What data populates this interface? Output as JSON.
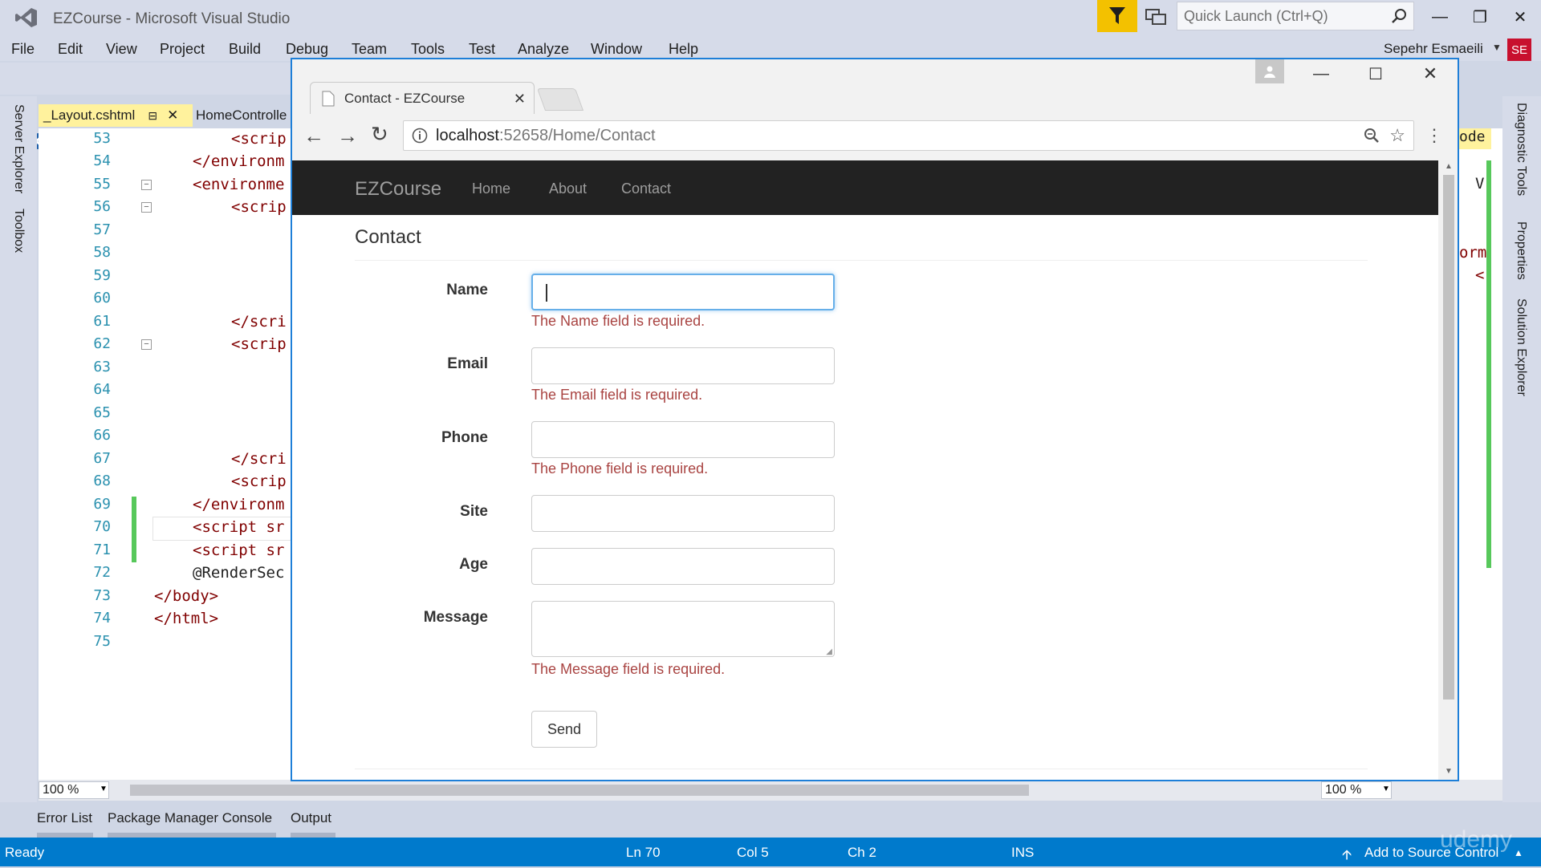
{
  "vs": {
    "title": "EZCourse - Microsoft Visual Studio",
    "quick_launch_placeholder": "Quick Launch (Ctrl+Q)",
    "menu": [
      "File",
      "Edit",
      "View",
      "Project",
      "Build",
      "Debug",
      "Team",
      "Tools",
      "Test",
      "Analyze",
      "Window",
      "Help"
    ],
    "user_name": "Sepehr Esmaeili",
    "user_initials": "SE",
    "left_panels": [
      "Server Explorer",
      "Toolbox"
    ],
    "right_panels": [
      "Diagnostic Tools",
      "Properties",
      "Solution Explorer"
    ],
    "tabs": [
      "_Layout.cshtml",
      "HomeControlle"
    ],
    "line_numbers": [
      "53",
      "54",
      "55",
      "56",
      "57",
      "58",
      "59",
      "60",
      "61",
      "62",
      "63",
      "64",
      "65",
      "66",
      "67",
      "68",
      "69",
      "70",
      "71",
      "72",
      "73",
      "74",
      "75"
    ],
    "code": {
      "l53": "<scrip",
      "l54": "</environm",
      "l55": "<environme",
      "l56": "<scrip",
      "l61": "</scri",
      "l62": "<scrip",
      "l67": "</scri",
      "l68": "<scrip",
      "l69": "</environm",
      "l70": "<script sr",
      "l71": "<script sr",
      "l72": "@RenderSec",
      "l73": "</body>",
      "l74": "</html>"
    },
    "right_code": [
      "ode",
      "V",
      "orm",
      "<"
    ],
    "zoom_left": "100 %",
    "zoom_right": "100 %",
    "toolwindows": [
      "Error List",
      "Package Manager Console",
      "Output"
    ],
    "status": {
      "ready": "Ready",
      "ln": "Ln 70",
      "col": "Col 5",
      "ch": "Ch 2",
      "ins": "INS",
      "source_control": "Add to Source Control",
      "watermark": "udemy"
    }
  },
  "browser": {
    "tab_title": "Contact - EZCourse",
    "url_host": "localhost",
    "url_rest": ":52658/Home/Contact",
    "site": {
      "brand": "EZCourse",
      "nav": [
        "Home",
        "About",
        "Contact"
      ],
      "heading": "Contact",
      "fields": {
        "name_label": "Name",
        "name_error": "The Name field is required.",
        "email_label": "Email",
        "email_error": "The Email field is required.",
        "phone_label": "Phone",
        "phone_error": "The Phone field is required.",
        "site_label": "Site",
        "age_label": "Age",
        "message_label": "Message",
        "message_error": "The Message field is required."
      },
      "send_label": "Send"
    }
  },
  "colors": {
    "vs_accent": "#007acc",
    "chrome_border": "#1e7fd8",
    "error_text": "#a94442",
    "navbar_bg": "#222222",
    "modified_tab": "#fff29d"
  }
}
